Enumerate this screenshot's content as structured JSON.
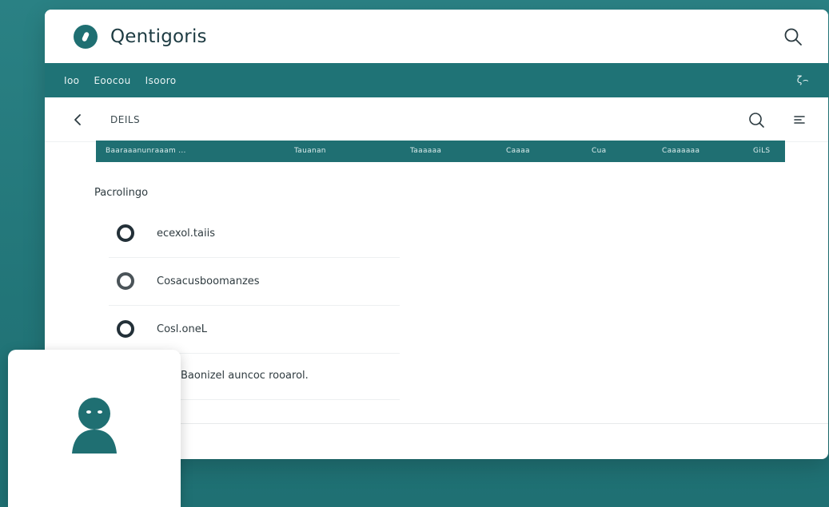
{
  "header": {
    "title": "Qentigoris",
    "search_icon": "search-icon"
  },
  "nav": {
    "items": [
      "Ioo",
      "Eoocou",
      "Isooro"
    ],
    "right": "ζ⌢"
  },
  "toolbar": {
    "back_icon": "chevron-left-icon",
    "title": "DEILS",
    "search_icon": "search-icon",
    "menu_icon": "menu-icon"
  },
  "table": {
    "columns": [
      "Baaraaanunraaam ...",
      "Tauanan",
      "Taaaaaa",
      "Caaaa",
      "Cua",
      "Caaaaaaa",
      "GiLS"
    ]
  },
  "section": {
    "title": "Pacrolingo"
  },
  "options": [
    {
      "label": "ecexol.taiis",
      "selected": true
    },
    {
      "label": "Cosacusboomanzes",
      "selected": false
    },
    {
      "label": "Cosl.oneL",
      "selected": true
    },
    {
      "label": "Baonizel auncoc rooarol.",
      "selected": false
    }
  ],
  "profile": {
    "avatar_icon": "user-avatar-icon"
  },
  "colors": {
    "background": "#237a7d",
    "accent": "#1f7376",
    "surface": "#ffffff"
  }
}
